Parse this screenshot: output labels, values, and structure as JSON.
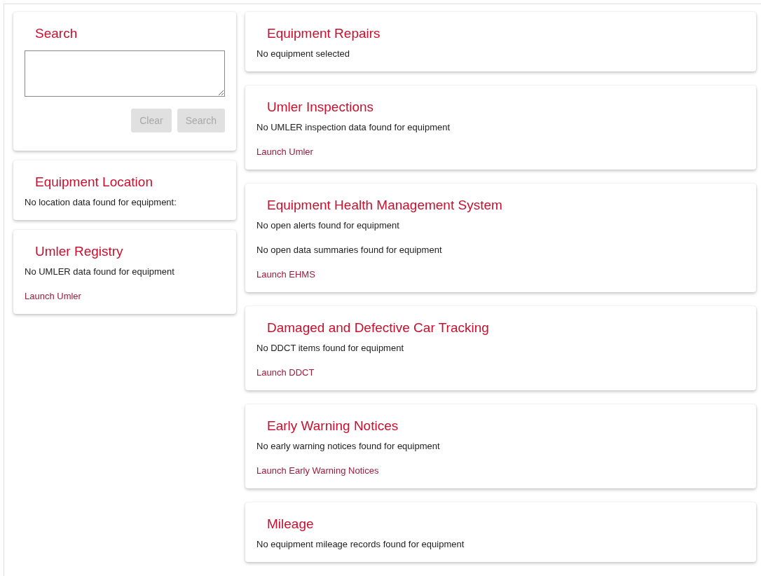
{
  "search_panel": {
    "title": "Search",
    "buttons": [
      {
        "label": "Clear",
        "disabled": true
      },
      {
        "label": "Search",
        "disabled": true
      }
    ]
  },
  "left_cards": [
    {
      "title": "Equipment Location",
      "lines": [
        {
          "kind": "text",
          "text": "No location data found for equipment:"
        }
      ]
    },
    {
      "title": "Umler Registry",
      "lines": [
        {
          "kind": "text",
          "text": "No UMLER data found for equipment"
        },
        {
          "kind": "link",
          "text": "Launch Umler"
        }
      ]
    }
  ],
  "right_cards": [
    {
      "title": "Equipment Repairs",
      "lines": [
        {
          "kind": "text",
          "text": "No equipment selected"
        }
      ]
    },
    {
      "title": "Umler Inspections",
      "lines": [
        {
          "kind": "text",
          "text": "No UMLER inspection data found for equipment"
        },
        {
          "kind": "link",
          "text": "Launch Umler"
        }
      ]
    },
    {
      "title": "Equipment Health Management System",
      "lines": [
        {
          "kind": "text",
          "text": "No open alerts found for equipment"
        },
        {
          "kind": "text",
          "text": "No open data summaries found for equipment"
        },
        {
          "kind": "link",
          "text": "Launch EHMS"
        }
      ]
    },
    {
      "title": "Damaged and Defective Car Tracking",
      "lines": [
        {
          "kind": "text",
          "text": "No DDCT items found for equipment"
        },
        {
          "kind": "link",
          "text": "Launch DDCT"
        }
      ]
    },
    {
      "title": "Early Warning Notices",
      "lines": [
        {
          "kind": "text",
          "text": "No early warning notices found for equipment"
        },
        {
          "kind": "link",
          "text": "Launch Early Warning Notices"
        }
      ]
    },
    {
      "title": "Mileage",
      "lines": [
        {
          "kind": "text",
          "text": "No equipment mileage records found for equipment"
        }
      ]
    }
  ]
}
